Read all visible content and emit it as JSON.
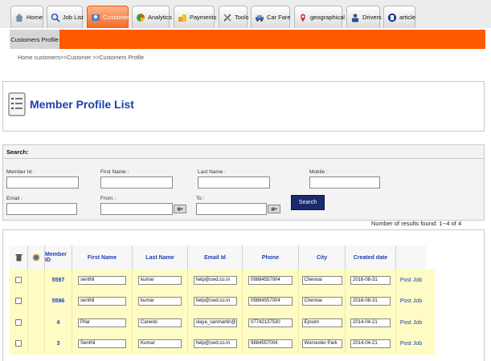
{
  "tabs": [
    {
      "label": "Home",
      "icon": "home-icon",
      "active": false
    },
    {
      "label": "Job List",
      "icon": "search-icon",
      "active": false
    },
    {
      "label": "Customer",
      "icon": "customer-icon",
      "active": true
    },
    {
      "label": "Analytics",
      "icon": "pie-chart-icon",
      "active": false
    },
    {
      "label": "Payments",
      "icon": "coins-icon",
      "active": false
    },
    {
      "label": "Tools",
      "icon": "tools-icon",
      "active": false
    },
    {
      "label": "Car Fare",
      "icon": "car-icon",
      "active": false
    },
    {
      "label": "geographical",
      "icon": "map-pin-icon",
      "active": false
    },
    {
      "label": "Drivers",
      "icon": "driver-icon",
      "active": false
    },
    {
      "label": "article",
      "icon": "article-icon",
      "active": false
    }
  ],
  "subnav": {
    "active_label": "Customers Profile"
  },
  "breadcrumb": "Home customers>>Customer >>Customers Profile",
  "page_title": "Member Profile List",
  "search": {
    "heading": "Search:",
    "fields": {
      "member_id": "Member Id :",
      "first_name": "First Name :",
      "last_name": "Last Name :",
      "mobile": "Mobile :",
      "email": "Email :",
      "from": "From :",
      "to": "To :"
    },
    "button": "Search"
  },
  "results_text": "Number of results found: 1--4  of  4",
  "table": {
    "columns": [
      "Member ID",
      "First Name",
      "Last Name",
      "Email Id",
      "Phone",
      "City",
      "Created date"
    ],
    "rows": [
      {
        "member_id": "5597",
        "first_name": "senthil",
        "last_name": "kumar",
        "email": "help@cwd.co.in",
        "phone": "09884557004",
        "city": "Chennai",
        "created": "2016-08-31",
        "action": "Post Job"
      },
      {
        "member_id": "5596",
        "first_name": "senthil",
        "last_name": "kumar",
        "email": "help@cwd.co.in",
        "phone": "09884557004",
        "city": "Chennai",
        "created": "2016-08-31",
        "action": "Post Job"
      },
      {
        "member_id": "4",
        "first_name": "Pilar",
        "last_name": "Canedo",
        "email": "olaya_sanmartin@h",
        "phone": "07742137530",
        "city": "Epsom",
        "created": "2014-04-21",
        "action": "Post Job"
      },
      {
        "member_id": "3",
        "first_name": "Senthil",
        "last_name": "Kumar",
        "email": "help@cwd.co.in",
        "phone": "9884557004",
        "city": "Worcester Park",
        "created": "2014-04-21",
        "action": "Post Job"
      }
    ]
  },
  "colors": {
    "accent_orange": "#fe5a00",
    "title_blue": "#1d3fae",
    "search_button": "#1a2a6e",
    "row_highlight": "#fefcc4"
  }
}
